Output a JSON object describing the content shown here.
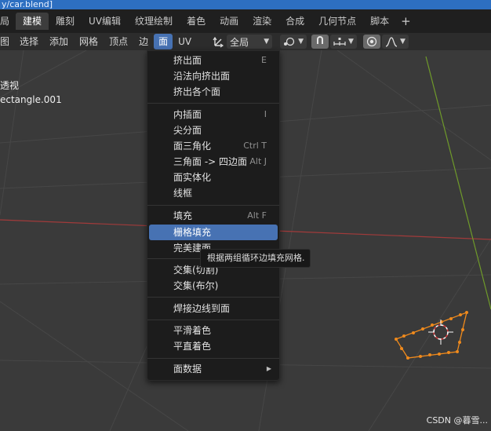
{
  "window": {
    "title": "y/car.blend]"
  },
  "workspaces": {
    "tabs": [
      "局",
      "建模",
      "雕刻",
      "UV编辑",
      "纹理绘制",
      "着色",
      "动画",
      "渲染",
      "合成",
      "几何节点",
      "脚本"
    ],
    "active_index": 1,
    "add_label": "+"
  },
  "header": {
    "menus": [
      "图",
      "选择",
      "添加",
      "网格",
      "顶点",
      "边",
      "面",
      "UV"
    ],
    "active_index": 6,
    "orientation_label": "全局"
  },
  "viewport": {
    "view_label": "透视",
    "object_label": "ectangle.001"
  },
  "face_menu": {
    "items": [
      {
        "label": "挤出面",
        "shortcut": "E"
      },
      {
        "label": "沿法向挤出面",
        "shortcut": ""
      },
      {
        "label": "挤出各个面",
        "shortcut": ""
      },
      {
        "label": "内插面",
        "shortcut": "I"
      },
      {
        "label": "尖分面",
        "shortcut": ""
      },
      {
        "label": "面三角化",
        "shortcut": "Ctrl T"
      },
      {
        "label": "三角面 -> 四边面",
        "shortcut": "Alt J"
      },
      {
        "label": "面实体化",
        "shortcut": ""
      },
      {
        "label": "线框",
        "shortcut": ""
      },
      {
        "label": "填充",
        "shortcut": "Alt F"
      },
      {
        "label": "栅格填充",
        "shortcut": ""
      },
      {
        "label": "完美建面",
        "shortcut": ""
      },
      {
        "label": "交集(切割)",
        "shortcut": ""
      },
      {
        "label": "交集(布尔)",
        "shortcut": ""
      },
      {
        "label": "焊接边线到面",
        "shortcut": ""
      },
      {
        "label": "平滑着色",
        "shortcut": ""
      },
      {
        "label": "平直着色",
        "shortcut": ""
      },
      {
        "label": "面数据",
        "shortcut": ""
      }
    ],
    "highlighted_index": 10,
    "submenu_arrow": "▶"
  },
  "tooltip": {
    "text": "根据两组循环边填充网格."
  },
  "watermark": {
    "text": "CSDN @暮雪..."
  },
  "colors": {
    "accent": "#4772b3",
    "title_bar": "#2d6fc1",
    "x_axis": "#a13a3a",
    "y_axis": "#6f9a2a",
    "mesh": "#f08a1c"
  }
}
